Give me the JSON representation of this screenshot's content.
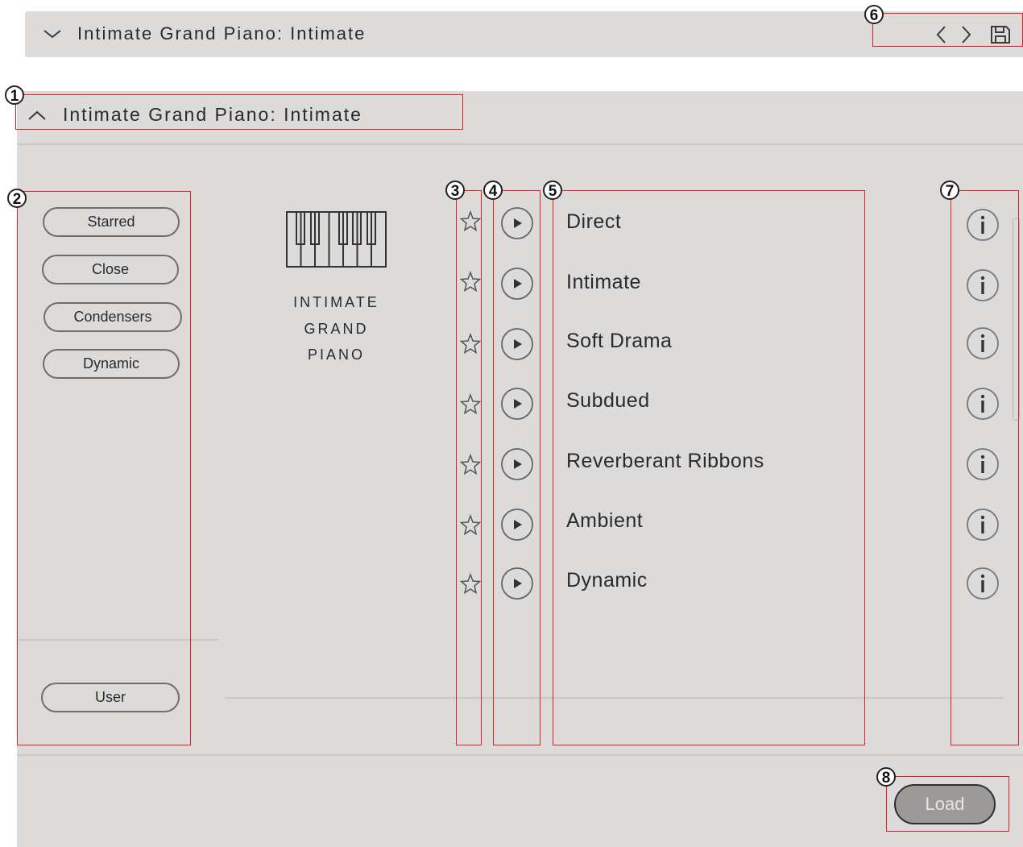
{
  "header": {
    "title": "Intimate Grand Piano: Intimate",
    "icons": [
      "chevron-down-icon",
      "chevron-left-icon",
      "chevron-right-icon",
      "save-icon"
    ]
  },
  "panel": {
    "title": "Intimate Grand Piano: Intimate",
    "collapse_icon": "chevron-up-icon"
  },
  "tags": {
    "items": [
      {
        "label": "Starred"
      },
      {
        "label": "Close"
      },
      {
        "label": "Condensers"
      },
      {
        "label": "Dynamic"
      }
    ],
    "user_label": "User"
  },
  "instrument": {
    "icon": "piano-icon",
    "name_lines": [
      "INTIMATE",
      "GRAND",
      "PIANO"
    ]
  },
  "presets": [
    {
      "name": "Direct"
    },
    {
      "name": "Intimate"
    },
    {
      "name": "Soft Drama"
    },
    {
      "name": "Subdued"
    },
    {
      "name": "Reverberant Ribbons"
    },
    {
      "name": "Ambient"
    },
    {
      "name": "Dynamic"
    }
  ],
  "footer": {
    "load_label": "Load"
  },
  "annotations": [
    "1",
    "2",
    "3",
    "4",
    "5",
    "6",
    "7",
    "8"
  ],
  "colors": {
    "panel_bg": "#dcdbda",
    "annotation": "#e32020",
    "load_button_bg": "#9b9a99"
  }
}
